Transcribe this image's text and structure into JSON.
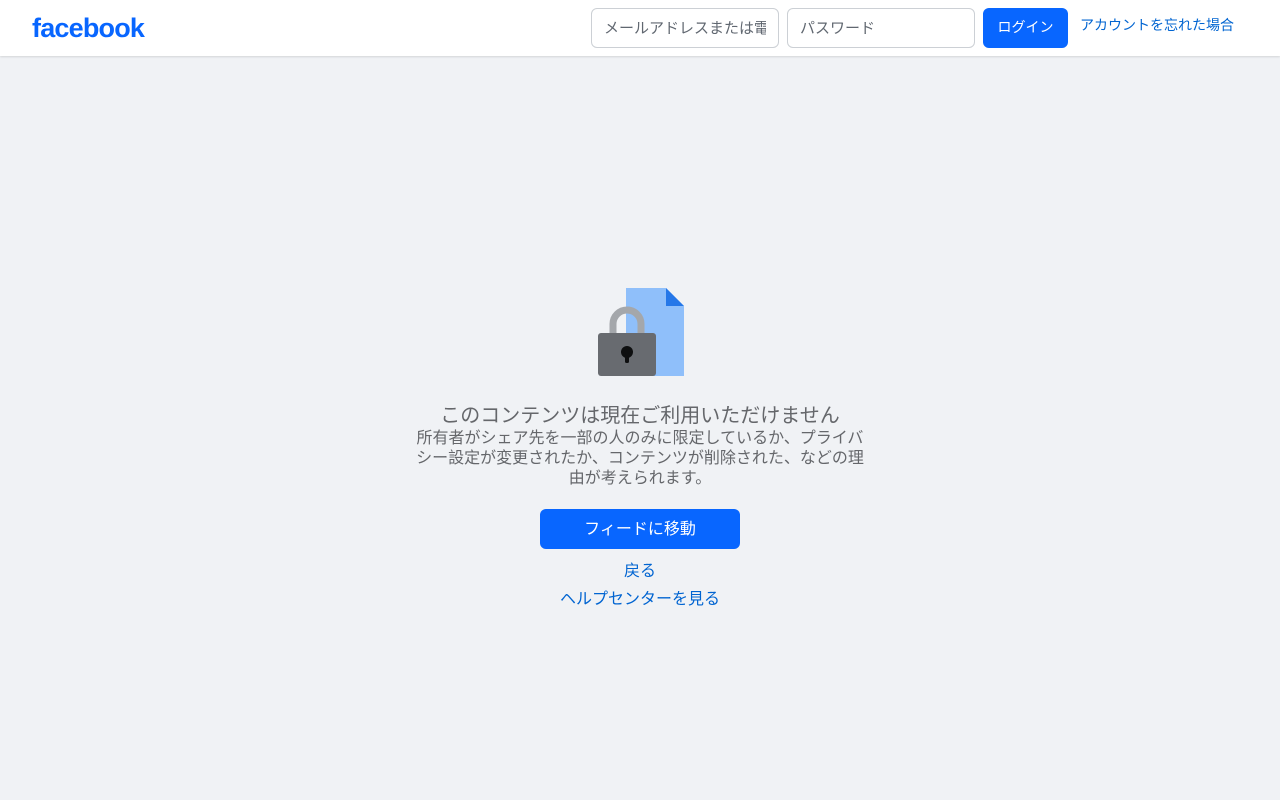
{
  "header": {
    "logo": "facebook",
    "email_placeholder": "メールアドレスまたは電話番号",
    "password_placeholder": "パスワード",
    "login_label": "ログイン",
    "forgot_label": "アカウントを忘れた場合"
  },
  "main": {
    "title": "このコンテンツは現在ご利用いただけません",
    "description": "所有者がシェア先を一部の人のみに限定しているか、プライバシー設定が変更されたか、コンテンツが削除された、などの理由が考えられます。",
    "feed_button_label": "フィードに移動",
    "back_label": "戻る",
    "help_label": "ヘルプセンターを見る"
  },
  "colors": {
    "brand": "#0866ff",
    "link": "#0064d1",
    "background": "#f0f2f5",
    "muted_text": "#65676b"
  },
  "icons": {
    "content_unavailable": "locked-document-icon"
  }
}
